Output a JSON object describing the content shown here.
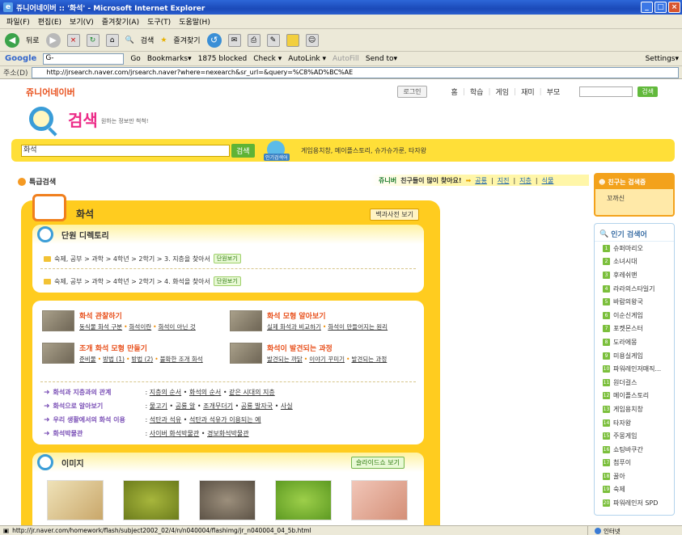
{
  "window": {
    "title": "쥬니어네이버 :: '화석' - Microsoft Internet Explorer"
  },
  "menu": [
    "파일(F)",
    "편집(E)",
    "보기(V)",
    "즐겨찾기(A)",
    "도구(T)",
    "도움말(H)"
  ],
  "toolbar": {
    "back": "뒤로",
    "search": "검색",
    "favorites": "즐겨찾기"
  },
  "google": {
    "logo": "Google",
    "input_value": "G-",
    "go": "Go",
    "bookmarks": "Bookmarks▾",
    "blocked": "1875 blocked",
    "check": "Check ▾",
    "autolink": "AutoLink ▾",
    "autofill": "AutoFill",
    "sendto": "Send to▾",
    "settings": "Settings▾"
  },
  "address": {
    "label": "주소(D)",
    "url": "http://jrsearch.naver.com/jrsearch.naver?where=nexearch&sr_url=&query=%C8%AD%BC%AE"
  },
  "topnav": {
    "login": "로그인",
    "items": [
      "홈",
      "학습",
      "게임",
      "재미",
      "부모"
    ],
    "search_btn": "검색"
  },
  "logo": {
    "brand": "쥬니어네이버",
    "search": "검색",
    "sub": "원하는 정보만 척척!"
  },
  "main_search": {
    "value": "화석",
    "button": "검색",
    "pop_tag": "인기검색어",
    "keywords": "게임용치창, 메이플스토리, 슈가슈가룬, 타자왕"
  },
  "adv_search": "특급검색",
  "friends_bar": {
    "brand": "쥬니버",
    "text": "친구들이 많이 찾아요!",
    "links": [
      "공룡",
      "지진",
      "지층",
      "식물"
    ]
  },
  "panel": {
    "title": "화석",
    "encyc_btn": "백과사전 보기",
    "unit_head": "단원 디렉토리",
    "unit_rows": [
      {
        "path": "숙제, 공부 > 과학 > 4학년 > 2학기 > 3. 지층을 찾아서",
        "btn": "단원보기"
      },
      {
        "path": "숙제, 공부 > 과학 > 4학년 > 2학기 > 4. 화석을 찾아서",
        "btn": "단원보기"
      }
    ],
    "topics": [
      {
        "title": "화석 관찰하기",
        "links": [
          "동식물 화석 구분",
          "화석이란",
          "화석이 아닌 것"
        ]
      },
      {
        "title": "화석 모형 알아보기",
        "links": [
          "실제 화석과 비교하기",
          "화석이 만들어지는 원리"
        ]
      },
      {
        "title": "조개 화석 모형 만들기",
        "links": [
          "준비물",
          "방법 (1)",
          "방법 (2)",
          "불확한 조개 화석"
        ]
      },
      {
        "title": "화석이 발견되는 과정",
        "links": [
          "발견되는 까닭",
          "이야기 꾸미기",
          "발견되는 과정"
        ]
      }
    ],
    "related": [
      {
        "label": "화석과 지층과의 관계",
        "links": [
          "지층의 순서",
          "화석의 순서",
          "같은 시대의 지층"
        ]
      },
      {
        "label": "화석으로 알아보기",
        "links": [
          "물고기",
          "공룡 알",
          "조개무더기",
          "공룡 발자국",
          "사실"
        ]
      },
      {
        "label": "우리 생활에서의 화석 이용",
        "links": [
          "석탄과 석유",
          "석탄과 석유가 이용되는 예"
        ]
      },
      {
        "label": "화석박물관",
        "links": [
          "사이버 화석박물관",
          "경보화석박물관"
        ]
      }
    ],
    "images_head": "이미지",
    "slideshow_btn": "슬라이드쇼 보기"
  },
  "friend_search": {
    "head": "친구는 검색중",
    "item": "꼬까신"
  },
  "popular": {
    "head": "인기 검색어",
    "items": [
      "슈퍼마리오",
      "소녀시대",
      "후레쉬맨",
      "라라의스타일기",
      "바람의왕국",
      "이순신게임",
      "포켓몬스터",
      "도라에몽",
      "미용실게임",
      "파워레인저매직...",
      "원더걸스",
      "메이플스토리",
      "게임용치창",
      "타자왕",
      "주몽게임",
      "쇼팅바쿠간",
      "첨푸이",
      "꿀아",
      "숙제",
      "파워레인저 SPD"
    ]
  },
  "status": {
    "url": "http://jr.naver.com/homework/flash/subject2002_02/4/n/n040004/flashimg/jr_n040004_04_5b.html",
    "zone": "인터넷"
  }
}
